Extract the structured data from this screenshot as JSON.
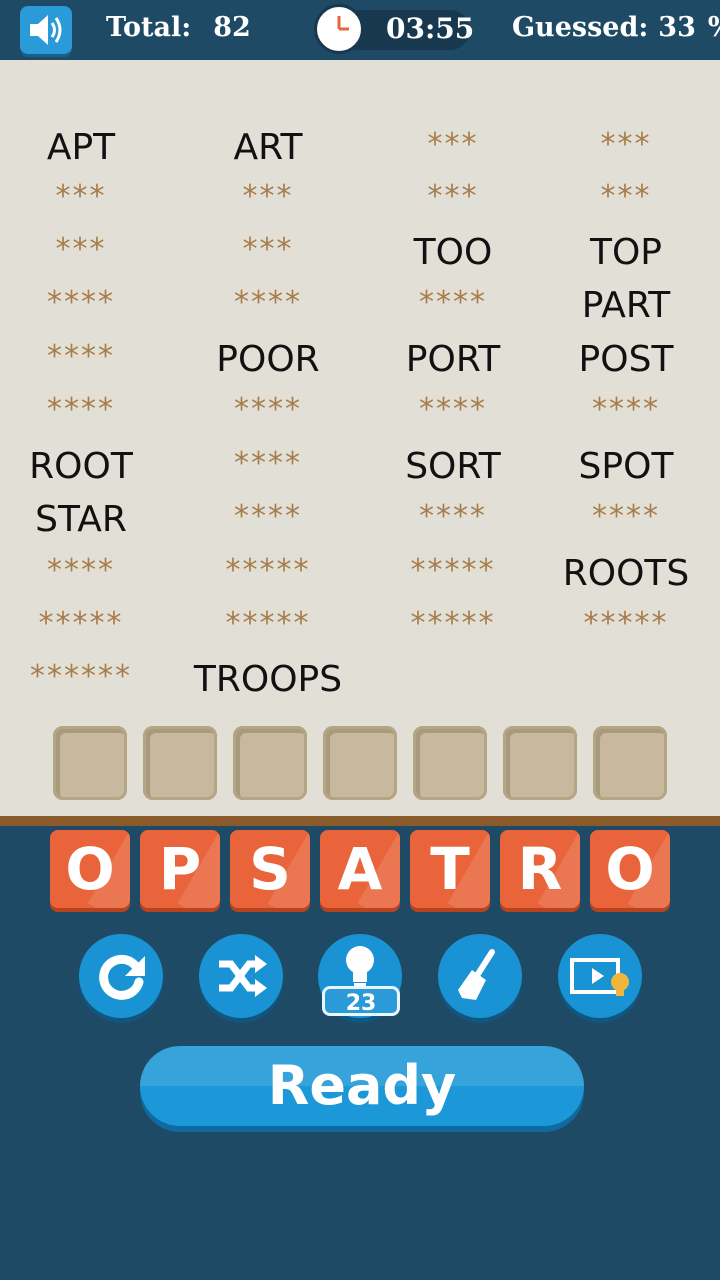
{
  "header": {
    "total_label": "Total:",
    "total_value": "82",
    "timer": "03:55",
    "guessed_label": "Guessed:",
    "guessed_value": "33",
    "guessed_unit": "%"
  },
  "words": [
    [
      "APT",
      "***",
      "***",
      "****",
      "****",
      "****",
      "ROOT",
      "STAR",
      "****",
      "*****",
      "******"
    ],
    [
      "ART",
      "***",
      "***",
      "****",
      "POOR",
      "****",
      "****",
      "****",
      "*****",
      "*****",
      "TROOPS"
    ],
    [
      "***",
      "***",
      "TOO",
      "****",
      "PORT",
      "****",
      "SORT",
      "****",
      "*****",
      "*****"
    ],
    [
      "***",
      "***",
      "TOP",
      "PART",
      "POST",
      "****",
      "SPOT",
      "****",
      "ROOTS",
      "*****"
    ]
  ],
  "letters": [
    "O",
    "P",
    "S",
    "A",
    "T",
    "R",
    "O"
  ],
  "hint_count": "23",
  "ready_label": "Ready",
  "colors": {
    "accent": "#1c97d7",
    "tile": "#e9643b",
    "background": "#1e4a66",
    "board": "#e2e0d6"
  },
  "icons": [
    "speaker-icon",
    "clock-icon",
    "restart-icon",
    "shuffle-icon",
    "lightbulb-icon",
    "broom-icon",
    "video-hint-icon"
  ]
}
